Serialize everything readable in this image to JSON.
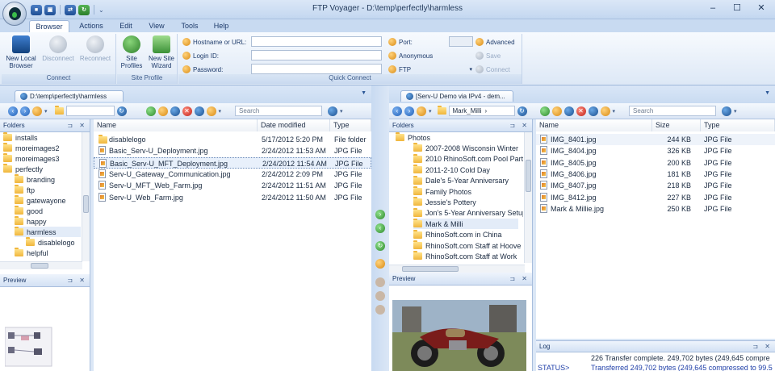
{
  "window": {
    "title": "FTP Voyager - D:\\temp\\perfectly\\harmless",
    "minimize": "–",
    "maximize": "☐",
    "close": "✕"
  },
  "ribbon_tabs": [
    "Browser",
    "Actions",
    "Edit",
    "View",
    "Tools",
    "Help"
  ],
  "ribbon": {
    "connect": {
      "label": "Connect",
      "new_local_browser": "New Local Browser",
      "disconnect": "Disconnect",
      "reconnect": "Reconnect"
    },
    "site_profile": {
      "label": "Site Profile",
      "site_profiles": "Site Profiles",
      "new_site_wizard": "New Site Wizard"
    },
    "quick_connect": {
      "label": "Quick Connect",
      "hostname": "Hostname or URL:",
      "login_id": "Login ID:",
      "password": "Password:",
      "port": "Port:",
      "anonymous": "Anonymous",
      "protocol": "FTP",
      "advanced": "Advanced",
      "save": "Save",
      "connect": "Connect"
    }
  },
  "left_browser": {
    "tab_label": "D:\\temp\\perfectly\\harmless",
    "search_placeholder": "Search",
    "folders_title": "Folders",
    "folders": [
      {
        "name": "installs",
        "level": 0
      },
      {
        "name": "moreimages2",
        "level": 0
      },
      {
        "name": "moreimages3",
        "level": 0
      },
      {
        "name": "perfectly",
        "level": 0
      },
      {
        "name": "branding",
        "level": 1
      },
      {
        "name": "ftp",
        "level": 1
      },
      {
        "name": "gatewayone",
        "level": 1
      },
      {
        "name": "good",
        "level": 1
      },
      {
        "name": "happy",
        "level": 1
      },
      {
        "name": "harmless",
        "level": 1
      },
      {
        "name": "disablelogo",
        "level": 2
      },
      {
        "name": "helpful",
        "level": 1
      }
    ],
    "preview_title": "Preview",
    "columns": [
      "Name",
      "Date modified",
      "Type"
    ],
    "files": [
      {
        "name": "disablelogo",
        "date": "5/17/2012 5:20 PM",
        "type": "File folder",
        "kind": "folder"
      },
      {
        "name": "Basic_Serv-U_Deployment.jpg",
        "date": "2/24/2012 11:53 AM",
        "type": "JPG File",
        "kind": "jpg"
      },
      {
        "name": "Basic_Serv-U_MFT_Deployment.jpg",
        "date": "2/24/2012 11:54 AM",
        "type": "JPG File",
        "kind": "jpg"
      },
      {
        "name": "Serv-U_Gateway_Communication.jpg",
        "date": "2/24/2012 2:09 PM",
        "type": "JPG File",
        "kind": "jpg"
      },
      {
        "name": "Serv-U_MFT_Web_Farm.jpg",
        "date": "2/24/2012 11:51 AM",
        "type": "JPG File",
        "kind": "jpg"
      },
      {
        "name": "Serv-U_Web_Farm.jpg",
        "date": "2/24/2012 11:50 AM",
        "type": "JPG File",
        "kind": "jpg"
      }
    ]
  },
  "right_browser": {
    "tab_label": "[Serv-U Demo via IPv4 - dem...",
    "path_label": "Mark_Milli",
    "search_placeholder": "Search",
    "folders_title": "Folders",
    "folders": [
      {
        "name": "Photos",
        "level": 0
      },
      {
        "name": "2007-2008 Wisconsin Winter",
        "level": 1
      },
      {
        "name": "2010 RhinoSoft.com Pool Part",
        "level": 1
      },
      {
        "name": "2011-2-10 Cold Day",
        "level": 1
      },
      {
        "name": "Dale's 5-Year Anniversary",
        "level": 1
      },
      {
        "name": "Family Photos",
        "level": 1
      },
      {
        "name": "Jessie's Pottery",
        "level": 1
      },
      {
        "name": "Jon's 5-Year Anniversary Setup",
        "level": 1
      },
      {
        "name": "Mark & Milli",
        "level": 1
      },
      {
        "name": "RhinoSoft.com in China",
        "level": 1
      },
      {
        "name": "RhinoSoft.com Staff at Hoove",
        "level": 1
      },
      {
        "name": "RhinoSoft.com Staff at Work",
        "level": 1
      }
    ],
    "preview_title": "Preview",
    "columns": [
      "Name",
      "Size",
      "Type"
    ],
    "files": [
      {
        "name": "IMG_8401.jpg",
        "size": "244 KB",
        "type": "JPG File"
      },
      {
        "name": "IMG_8404.jpg",
        "size": "326 KB",
        "type": "JPG File"
      },
      {
        "name": "IMG_8405.jpg",
        "size": "200 KB",
        "type": "JPG File"
      },
      {
        "name": "IMG_8406.jpg",
        "size": "181 KB",
        "type": "JPG File"
      },
      {
        "name": "IMG_8407.jpg",
        "size": "218 KB",
        "type": "JPG File"
      },
      {
        "name": "IMG_8412.jpg",
        "size": "227 KB",
        "type": "JPG File"
      },
      {
        "name": "Mark & Millie.jpg",
        "size": "250 KB",
        "type": "JPG File"
      }
    ]
  },
  "log": {
    "title": "Log",
    "line1": "226 Transfer complete. 249,702 bytes (249,645 compre",
    "status_label": "STATUS>",
    "line2": "Transferred 249,702 bytes (249,645 compressed to 99.5"
  },
  "colors": {
    "accent": "#2b5797",
    "ribbon_bg": "#dde8f6",
    "status_text": "#1f3fa8"
  }
}
